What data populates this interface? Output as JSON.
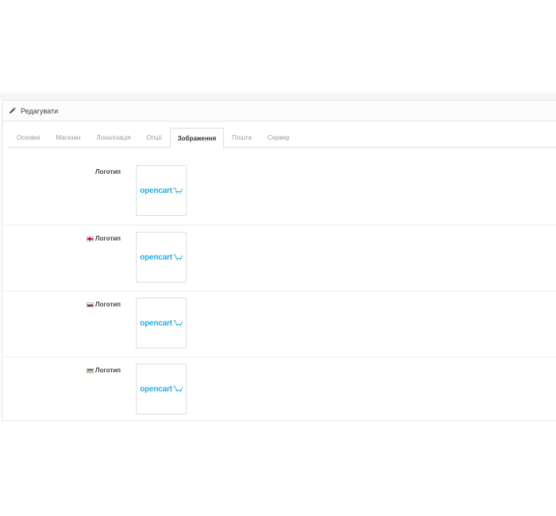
{
  "panel": {
    "title": "Редагувати",
    "icon": "pencil-icon"
  },
  "tabs": [
    {
      "label": "Основні",
      "active": false
    },
    {
      "label": "Магазин",
      "active": false
    },
    {
      "label": "Локалізація",
      "active": false
    },
    {
      "label": "Опції",
      "active": false
    },
    {
      "label": "Зображення",
      "active": true
    },
    {
      "label": "Пошта",
      "active": false
    },
    {
      "label": "Сервер",
      "active": false
    }
  ],
  "rows": [
    {
      "label": "Логотип",
      "flag": null,
      "logo_text": "opencart"
    },
    {
      "label": "Логотип",
      "flag": "gb-flag-icon",
      "logo_text": "opencart"
    },
    {
      "label": "Логотип",
      "flag": "ru-flag-icon",
      "logo_text": "opencart"
    },
    {
      "label": "Логотип",
      "flag": "ua-flag-icon",
      "logo_text": "opencart"
    }
  ],
  "colors": {
    "logo": "#2aace2",
    "active_tab_text": "#333333",
    "inactive_tab_text": "#9c9c9c"
  }
}
